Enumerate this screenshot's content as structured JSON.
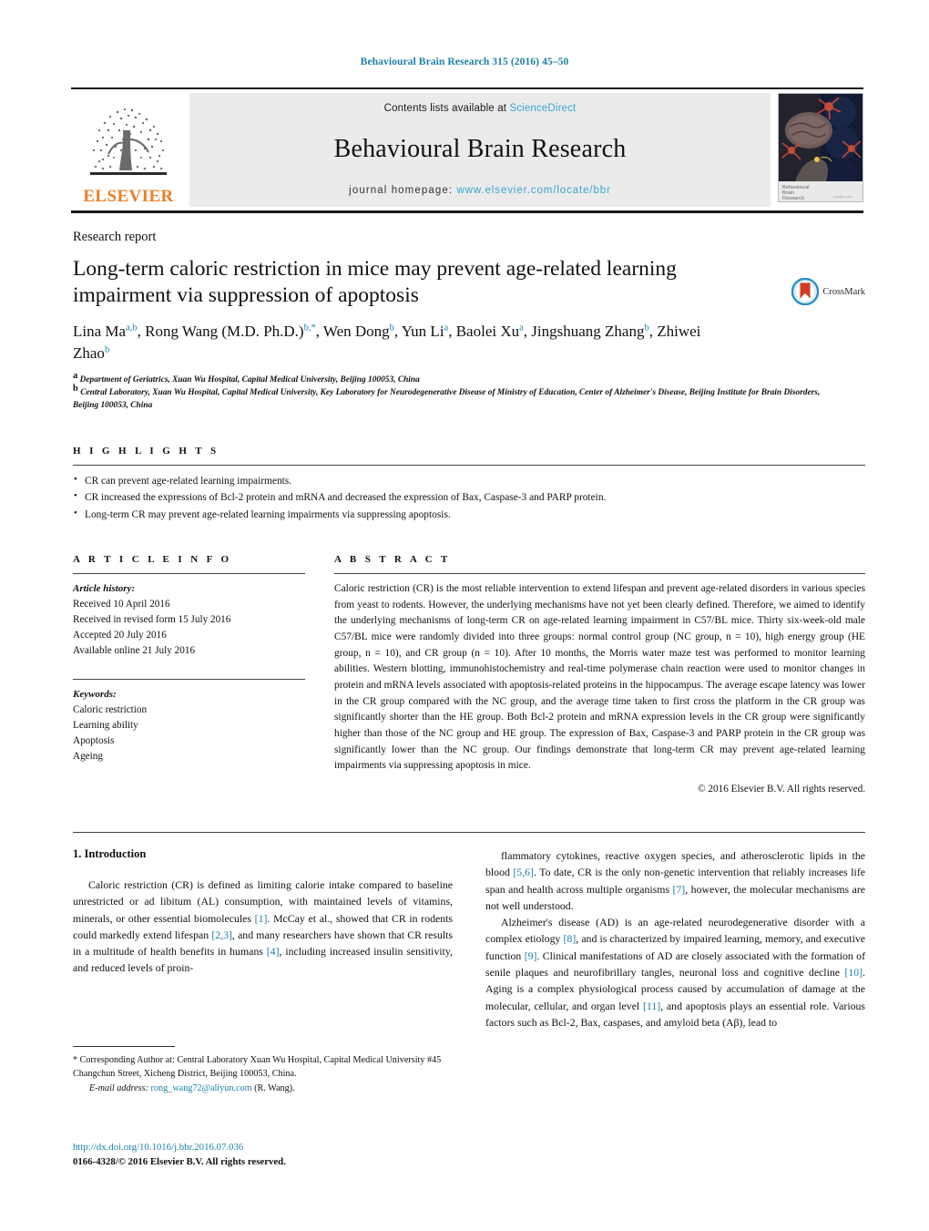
{
  "running_head": "Behavioural Brain Research 315 (2016) 45–50",
  "masthead": {
    "contents_prefix": "Contents lists available at ",
    "contents_link": "ScienceDirect",
    "journal_title": "Behavioural Brain Research",
    "homepage_prefix": "journal homepage:",
    "homepage_url": "www.elsevier.com/locate/bbr",
    "publisher": "ELSEVIER",
    "cover_caption_line1": "Behavioural",
    "cover_caption_line2": "Brain",
    "cover_caption_line3": "Research"
  },
  "article": {
    "type_label": "Research report",
    "title": "Long-term caloric restriction in mice may prevent age-related learning impairment via suppression of apoptosis",
    "crossmark_label": "CrossMark",
    "authors_html": "Lina Ma<sup>a,b</sup>, Rong Wang (M.D. Ph.D.)<sup>b,*</sup>, Wen Dong<sup>b</sup>, Yun Li<sup>a</sup>, Baolei Xu<sup>a</sup>, Jingshuang Zhang<sup>b</sup>, Zhiwei Zhao<sup>b</sup>",
    "affiliations": [
      "Department of Geriatrics, Xuan Wu Hospital, Capital Medical University, Beijing 100053, China",
      "Central Laboratory, Xuan Wu Hospital, Capital Medical University, Key Laboratory for Neurodegenerative Disease of Ministry of Education, Center of Alzheimer's Disease, Beijing Institute for Brain Disorders, Beijing 100053, China"
    ],
    "affiliation_marks": [
      "a",
      "b"
    ]
  },
  "highlights": {
    "heading": "H I G H L I G H T S",
    "items": [
      "CR can prevent age-related learning impairments.",
      "CR increased the expressions of Bcl-2 protein and mRNA and decreased the expression of Bax, Caspase-3 and PARP protein.",
      "Long-term CR may prevent age-related learning impairments via suppressing apoptosis."
    ]
  },
  "article_info": {
    "heading": "A R T I C L E    I N F O",
    "history_label": "Article history:",
    "history": [
      "Received 10 April 2016",
      "Received in revised form 15 July 2016",
      "Accepted 20 July 2016",
      "Available online 21 July 2016"
    ],
    "keywords_label": "Keywords:",
    "keywords": [
      "Caloric restriction",
      "Learning ability",
      "Apoptosis",
      "Ageing"
    ]
  },
  "abstract": {
    "heading": "A B S T R A C T",
    "text": "Caloric restriction (CR) is the most reliable intervention to extend lifespan and prevent age-related disorders in various species from yeast to rodents. However, the underlying mechanisms have not yet been clearly defined. Therefore, we aimed to identify the underlying mechanisms of long-term CR on age-related learning impairment in C57/BL mice. Thirty six-week-old male C57/BL mice were randomly divided into three groups: normal control group (NC group, n = 10), high energy group (HE group, n = 10), and CR group (n = 10). After 10 months, the Morris water maze test was performed to monitor learning abilities. Western blotting, immunohistochemistry and real-time polymerase chain reaction were used to monitor changes in protein and mRNA levels associated with apoptosis-related proteins in the hippocampus. The average escape latency was lower in the CR group compared with the NC group, and the average time taken to first cross the platform in the CR group was significantly shorter than the HE group. Both Bcl-2 protein and mRNA expression levels in the CR group were significantly higher than those of the NC group and HE group. The expression of Bax, Caspase-3 and PARP protein in the CR group was significantly lower than the NC group. Our findings demonstrate that long-term CR may prevent age-related learning impairments via suppressing apoptosis in mice.",
    "copyright": "© 2016 Elsevier B.V. All rights reserved."
  },
  "introduction": {
    "heading": "1.  Introduction",
    "left_paragraph_html": "Caloric restriction (CR) is defined as limiting calorie intake compared to baseline unrestricted or ad libitum (AL) consumption, with maintained levels of vitamins, minerals, or other essential biomolecules <span class=\"ref\">[1]</span>. McCay et al., showed that CR in rodents could markedly extend lifespan <span class=\"ref\">[2,3]</span>, and many researchers have shown that CR results in a multitude of health benefits in humans <span class=\"ref\">[4]</span>, including increased insulin sensitivity, and reduced levels of proin-",
    "right_paragraph1_html": "flammatory cytokines, reactive oxygen species, and atherosclerotic lipids in the blood <span class=\"ref\">[5,6]</span>. To date, CR is the only non-genetic intervention that reliably increases life span and health across multiple organisms <span class=\"ref\">[7]</span>, however, the molecular mechanisms are not well understood.",
    "right_paragraph2_html": "Alzheimer's disease (AD) is an age-related neurodegenerative disorder with a complex etiology <span class=\"ref\">[8]</span>, and is characterized by impaired learning, memory, and executive function <span class=\"ref\">[9]</span>. Clinical manifestations of AD are closely associated with the formation of senile plaques and neurofibrillary tangles, neuronal loss and cognitive decline <span class=\"ref\">[10]</span>. Aging is a complex physiological process caused by accumulation of damage at the molecular, cellular, and organ level <span class=\"ref\">[11]</span>, and apoptosis plays an essential role. Various factors such as Bcl-2, Bax, caspases, and amyloid beta (Aβ), lead to"
  },
  "footnote": {
    "corresponding_html": "<span class=\"star\">*</span> Corresponding Author at: Central Laboratory Xuan Wu Hospital, Capital Medical University #45 Changchun Street, Xicheng District, Beijing 100053, China.",
    "email_label": "E-mail address:",
    "email": "rong_wang72@aliyun.com",
    "email_suffix": "(R. Wang).",
    "doi": "http://dx.doi.org/10.1016/j.bbr.2016.07.036",
    "issn_line": "0166-4328/© 2016 Elsevier B.V. All rights reserved."
  },
  "colors": {
    "link_blue": "#1a7fa8",
    "science_direct_blue": "#3aa3d4",
    "elsevier_orange": "#ef7d22",
    "masthead_grey": "#ebebeb"
  }
}
